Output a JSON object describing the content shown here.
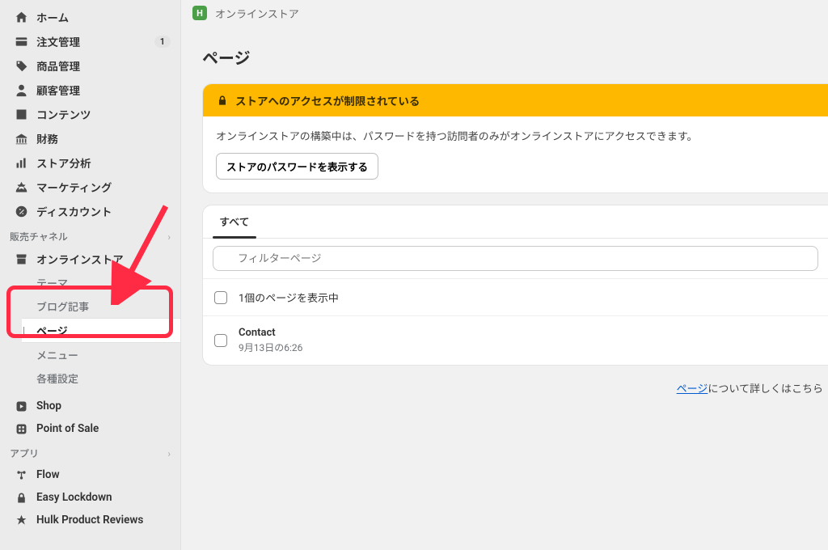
{
  "topbar": {
    "title": "オンラインストア"
  },
  "page": {
    "title": "ページ"
  },
  "sidebar": {
    "nav": [
      {
        "label": "ホーム",
        "icon": "home-icon"
      },
      {
        "label": "注文管理",
        "icon": "orders-icon",
        "badge": "1"
      },
      {
        "label": "商品管理",
        "icon": "products-icon"
      },
      {
        "label": "顧客管理",
        "icon": "customers-icon"
      },
      {
        "label": "コンテンツ",
        "icon": "content-icon"
      },
      {
        "label": "財務",
        "icon": "finance-icon"
      },
      {
        "label": "ストア分析",
        "icon": "analytics-icon"
      },
      {
        "label": "マーケティング",
        "icon": "marketing-icon"
      },
      {
        "label": "ディスカウント",
        "icon": "discounts-icon"
      }
    ],
    "channels_label": "販売チャネル",
    "online_store": {
      "label": "オンラインストア",
      "children": [
        {
          "label": "テーマ"
        },
        {
          "label": "ブログ記事"
        },
        {
          "label": "ページ",
          "active": true
        },
        {
          "label": "メニュー"
        },
        {
          "label": "各種設定"
        }
      ]
    },
    "channel_items": [
      {
        "label": "Shop",
        "icon": "shop-icon"
      },
      {
        "label": "Point of Sale",
        "icon": "pos-icon"
      }
    ],
    "apps_label": "アプリ",
    "apps": [
      {
        "label": "Flow",
        "icon": "flow-icon"
      },
      {
        "label": "Easy Lockdown",
        "icon": "lock-icon"
      },
      {
        "label": "Hulk Product Reviews",
        "icon": "reviews-icon"
      }
    ]
  },
  "alert": {
    "title": "ストアへのアクセスが制限されている",
    "body": "オンラインストアの構築中は、パスワードを持つ訪問者のみがオンラインストアにアクセスできます。",
    "button": "ストアのパスワードを表示する"
  },
  "list": {
    "tab_all": "すべて",
    "filter_placeholder": "フィルターページ",
    "count_text": "1個のページを表示中",
    "rows": [
      {
        "title": "Contact",
        "subtitle": "9月13日の6:26"
      }
    ]
  },
  "footer": {
    "link_text": "ページ",
    "suffix": "について詳しくはこちら"
  },
  "colors": {
    "highlight": "#ff2a44",
    "banner": "#ffb800"
  }
}
